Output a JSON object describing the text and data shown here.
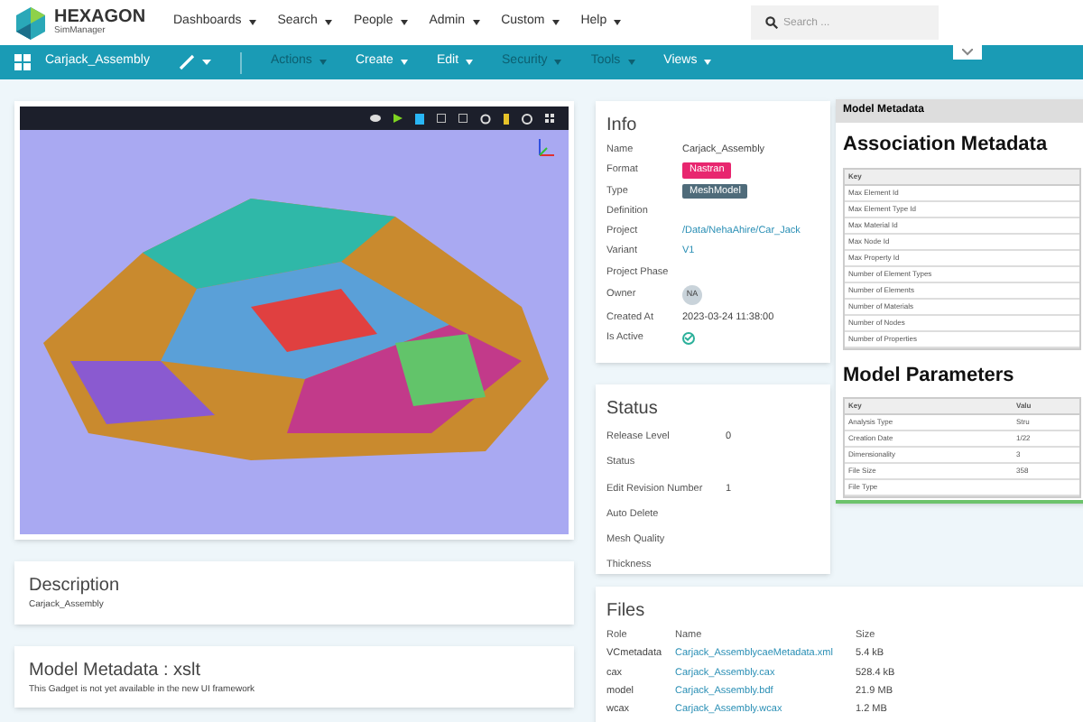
{
  "header": {
    "logo_name": "HEXAGON",
    "logo_sub": "SimManager",
    "menus": [
      "Dashboards",
      "Search",
      "People",
      "Admin",
      "Custom",
      "Help"
    ],
    "search": {
      "placeholder": "Search ..."
    }
  },
  "toolbar": {
    "title": "Carjack_Assembly",
    "items": [
      {
        "label": "Actions",
        "disabled": true
      },
      {
        "label": "Create",
        "disabled": false
      },
      {
        "label": "Edit",
        "disabled": false
      },
      {
        "label": "Security",
        "disabled": true
      },
      {
        "label": "Tools",
        "disabled": true
      },
      {
        "label": "Views",
        "disabled": false
      }
    ]
  },
  "description": {
    "title": "Description",
    "text": "Carjack_Assembly"
  },
  "model_metadata_xslt": {
    "title": "Model Metadata : xslt",
    "text": "This Gadget is not yet available in the new UI framework"
  },
  "info": {
    "title": "Info",
    "fields": [
      {
        "label": "Name",
        "value": "Carjack_Assembly",
        "kind": "text"
      },
      {
        "label": "Format",
        "value": "Nastran",
        "kind": "badge",
        "color": "#e8266f"
      },
      {
        "label": "Type",
        "value": "MeshModel",
        "kind": "badge",
        "color": "#4f6b7a"
      },
      {
        "label": "Definition",
        "kind": "text"
      },
      {
        "label": "Project",
        "value": "/Data/NehaAhire/Car_Jack",
        "kind": "link"
      },
      {
        "label": "Variant",
        "value": "V1",
        "kind": "link"
      },
      {
        "label": "Project Phase",
        "kind": "text"
      },
      {
        "label": "Owner",
        "value": "NA",
        "kind": "avatar"
      },
      {
        "label": "Created At",
        "value": "2023-03-24 11:38:00",
        "kind": "text"
      },
      {
        "label": "Is Active",
        "kind": "check",
        "checked": true
      }
    ]
  },
  "status": {
    "title": "Status",
    "fields": [
      {
        "label": "Release Level",
        "value": "0"
      },
      {
        "label": "Status"
      },
      {
        "label": "Edit Revision Number",
        "value": "1"
      },
      {
        "label": "Auto Delete"
      },
      {
        "label": "Mesh Quality"
      },
      {
        "label": "Thickness"
      }
    ]
  },
  "files": {
    "title": "Files",
    "columns": [
      "Role",
      "Name",
      "Size"
    ],
    "rows": [
      {
        "role": "VCmetadata",
        "name": "Carjack_AssemblycaeMetadata.xml",
        "size": "5.4 kB"
      },
      {
        "role": "cax",
        "name": "Carjack_Assembly.cax",
        "size": "528.4 kB"
      },
      {
        "role": "model",
        "name": "Carjack_Assembly.bdf",
        "size": "21.9 MB"
      },
      {
        "role": "wcax",
        "name": "Carjack_Assembly.wcax",
        "size": "1.2 MB"
      }
    ]
  },
  "metadata_panel": {
    "title": "Model Metadata",
    "association": {
      "title": "Association Metadata",
      "column": "Key",
      "rows": [
        "Max Element Id",
        "Max Element Type Id",
        "Max Material Id",
        "Max Node Id",
        "Max Property Id",
        "Number of Element Types",
        "Number of Elements",
        "Number of Materials",
        "Number of Nodes",
        "Number of Properties"
      ]
    },
    "parameters": {
      "title": "Model Parameters",
      "columns": [
        "Key",
        "Valu"
      ],
      "rows": [
        {
          "key": "Analysis Type",
          "value": "Stru"
        },
        {
          "key": "Creation Date",
          "value": "1/22"
        },
        {
          "key": "Dimensionality",
          "value": "3"
        },
        {
          "key": "File Size",
          "value": "358"
        },
        {
          "key": "File Type"
        }
      ]
    }
  }
}
